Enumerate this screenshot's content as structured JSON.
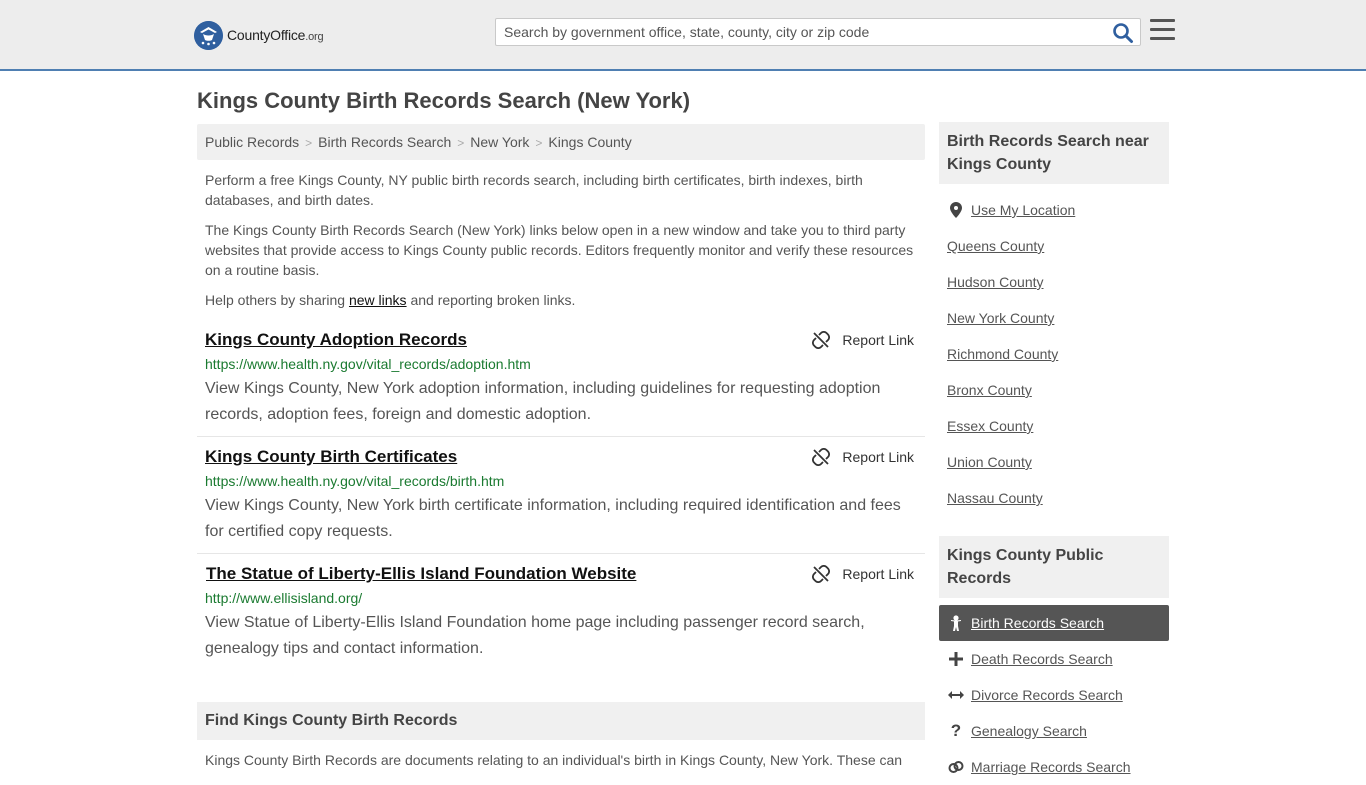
{
  "header": {
    "logo_text_main": "CountyOffice",
    "logo_text_tld": ".org",
    "search_placeholder": "Search by government office, state, county, city or zip code"
  },
  "page": {
    "title": "Kings County Birth Records Search (New York)",
    "breadcrumb": [
      "Public Records",
      "Birth Records Search",
      "New York",
      "Kings County"
    ],
    "intro": [
      "Perform a free Kings County, NY public birth records search, including birth certificates, birth indexes, birth databases, and birth dates.",
      "The Kings County Birth Records Search (New York) links below open in a new window and take you to third party websites that provide access to Kings County public records. Editors frequently monitor and verify these resources on a routine basis."
    ],
    "help_prefix": "Help others by sharing ",
    "help_link": "new links",
    "help_suffix": " and reporting broken links."
  },
  "results": [
    {
      "title": "Kings County Adoption Records",
      "url": "https://www.health.ny.gov/vital_records/adoption.htm",
      "description": "View Kings County, New York adoption information, including guidelines for requesting adoption records, adoption fees, foreign and domestic adoption.",
      "report_label": "Report Link"
    },
    {
      "title": "Kings County Birth Certificates",
      "url": "https://www.health.ny.gov/vital_records/birth.htm",
      "description": "View Kings County, New York birth certificate information, including required identification and fees for certified copy requests.",
      "report_label": "Report Link"
    },
    {
      "title": "The Statue of Liberty-Ellis Island Foundation Website",
      "url": "http://www.ellisisland.org/",
      "description": "View Statue of Liberty-Ellis Island Foundation home page including passenger record search, genealogy tips and contact information.",
      "report_label": "Report Link"
    }
  ],
  "find": {
    "heading": "Find Kings County Birth Records",
    "text": "Kings County Birth Records are documents relating to an individual's birth in Kings County, New York. These can"
  },
  "sidebar": {
    "nearby_heading": "Birth Records Search near Kings County",
    "use_location": "Use My Location",
    "nearby": [
      "Queens County",
      "Hudson County",
      "New York County",
      "Richmond County",
      "Bronx County",
      "Essex County",
      "Union County",
      "Nassau County"
    ],
    "public_heading": "Kings County Public Records",
    "public_links": [
      {
        "label": "Birth Records Search",
        "icon": "baby-icon",
        "active": true
      },
      {
        "label": "Death Records Search",
        "icon": "cross-icon",
        "active": false
      },
      {
        "label": "Divorce Records Search",
        "icon": "split-arrows-icon",
        "active": false
      },
      {
        "label": "Genealogy Search",
        "icon": "question-icon",
        "active": false
      },
      {
        "label": "Marriage Records Search",
        "icon": "rings-icon",
        "active": false
      }
    ]
  },
  "colors": {
    "accent_border": "#4f7fb2",
    "url_green": "#1a7a30",
    "active_bg": "#555555"
  }
}
